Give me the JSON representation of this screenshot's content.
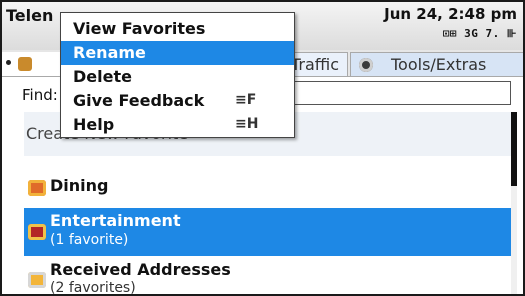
{
  "app": {
    "title": "Telen"
  },
  "status": {
    "datetime": "Jun 24, 2:48 pm",
    "icons": "⊡⊞ 3G 7. ⊪"
  },
  "tabs": {
    "traffic": "Traffic",
    "tools": "Tools/Extras"
  },
  "find": {
    "label": "Find:",
    "value": ""
  },
  "list": {
    "create": "Create New Favorite",
    "items": [
      {
        "name": "Dining",
        "sub": ""
      },
      {
        "name": "Entertainment",
        "sub": "(1 favorite)"
      },
      {
        "name": "Received Addresses",
        "sub": "(2 favorites)"
      }
    ]
  },
  "menu": {
    "items": [
      {
        "label": "View Favorites",
        "shortcut": ""
      },
      {
        "label": "Rename",
        "shortcut": ""
      },
      {
        "label": "Delete",
        "shortcut": ""
      },
      {
        "label": "Give Feedback",
        "shortcut": "≡F"
      },
      {
        "label": "Help",
        "shortcut": "≡H"
      }
    ],
    "selected_index": 1
  },
  "colors": {
    "highlight": "#1e88e5",
    "frame": "#1a1a1a"
  }
}
